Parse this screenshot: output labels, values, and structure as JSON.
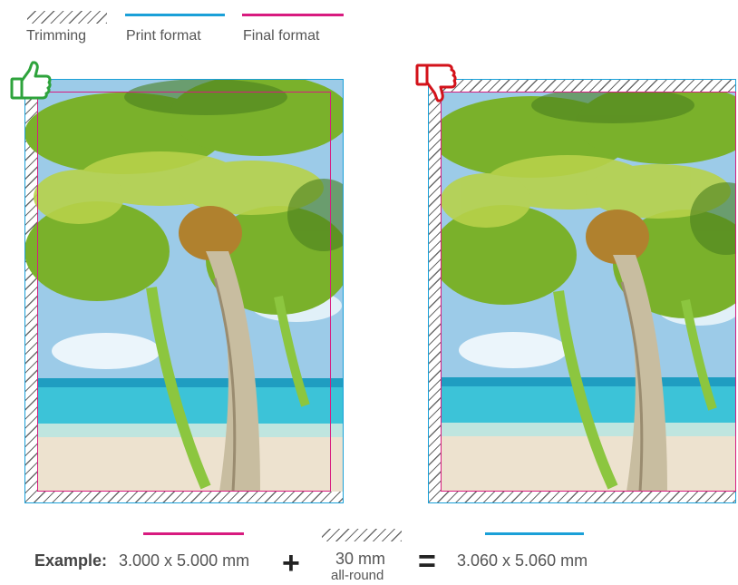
{
  "legend": {
    "trimming_label": "Trimming",
    "print_format_label": "Print format",
    "final_format_label": "Final format"
  },
  "colors": {
    "print_format": "#1aa0d8",
    "final_format": "#d81b7f",
    "good": "#2ea33c",
    "bad": "#d3121a"
  },
  "panels": {
    "left_icon": "thumbs-up-icon",
    "right_icon": "thumbs-down-icon"
  },
  "example": {
    "label": "Example",
    "separator": ":",
    "final_size": "3.000 x 5.000 mm",
    "bleed_value": "30 mm",
    "bleed_note": "all-round",
    "print_size": "3.060 x 5.060 mm"
  }
}
